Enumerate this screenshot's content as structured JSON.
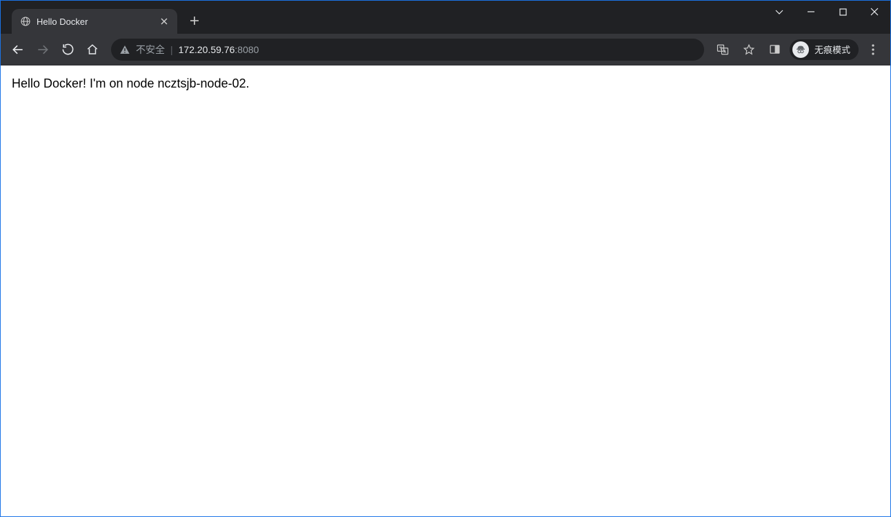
{
  "browser": {
    "tab": {
      "title": "Hello Docker"
    },
    "omnibox": {
      "security_label": "不安全",
      "url_host": "172.20.59.76",
      "url_port": ":8080"
    },
    "incognito_label": "无痕模式"
  },
  "page": {
    "body_text": "Hello Docker! I'm on node ncztsjb-node-02."
  }
}
